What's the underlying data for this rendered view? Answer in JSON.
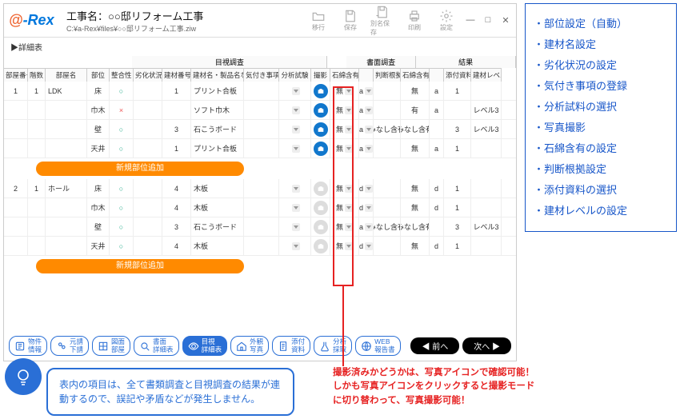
{
  "window": {
    "title_prefix": "工事名：",
    "title": "○○邸リフォーム工事",
    "path": "C:¥a-Rex¥files¥○○邸リフォーム工事.ziw",
    "toolbar": {
      "items": [
        {
          "name": "open-icon",
          "label": "移行"
        },
        {
          "name": "save-icon",
          "label": "保存"
        },
        {
          "name": "saveas-icon",
          "label": "別名保存"
        },
        {
          "name": "print-icon",
          "label": "印刷"
        },
        {
          "name": "settings-icon",
          "label": "設定"
        }
      ]
    },
    "crumb": "▶詳細表"
  },
  "header_groups": {
    "visual": "目視調査",
    "doc": "書面調査",
    "result": "結果"
  },
  "columns": {
    "a": "部屋番号",
    "b": "階数",
    "c": "部屋名",
    "d": "部位",
    "e": "整合性",
    "f": "劣化状況",
    "f2": "建材番号",
    "g": "",
    "h": "建材名・製品名など",
    "i": "気付き事項",
    "j": "分析試験",
    "k": "撮影",
    "l": "石綿含有",
    "m": "",
    "n": "判断根拠",
    "o": "石綿含有",
    "p": "",
    "q": "添付資料",
    "r": "建材レベル"
  },
  "rooms": [
    {
      "room_no": "1",
      "floor": "1",
      "room_name": "LDK",
      "rows": [
        {
          "part": "床",
          "fit": "○",
          "deg": "",
          "bno": "1",
          "bname": "プリント合板",
          "note": "",
          "anal": "",
          "cam": true,
          "asb1": "無",
          "code1": "a",
          "basis": "",
          "asb2": "無",
          "code2": "a",
          "doc": "1",
          "level": ""
        },
        {
          "part": "巾木",
          "fit": "×",
          "deg": "",
          "bno": "",
          "bname": "ソフト巾木",
          "note": "",
          "anal": "",
          "cam": true,
          "asb1": "無",
          "code1": "a",
          "basis": "",
          "asb2": "有",
          "code2": "a",
          "doc": "",
          "level": "レベル3"
        },
        {
          "part": "壁",
          "fit": "○",
          "deg": "",
          "bno": "3",
          "bname": "石こうボード",
          "note": "",
          "anal": "",
          "cam": true,
          "asb1": "無",
          "code1": "a",
          "basis": "みなし含有",
          "asb2": "みなし含有",
          "code2": "",
          "doc": "3",
          "level": "レベル3"
        },
        {
          "part": "天井",
          "fit": "○",
          "deg": "",
          "bno": "1",
          "bname": "プリント合板",
          "note": "",
          "anal": "",
          "cam": true,
          "asb1": "無",
          "code1": "a",
          "basis": "",
          "asb2": "無",
          "code2": "a",
          "doc": "1",
          "level": ""
        }
      ]
    },
    {
      "room_no": "2",
      "floor": "1",
      "room_name": "ホール",
      "rows": [
        {
          "part": "床",
          "fit": "○",
          "deg": "",
          "bno": "4",
          "bname": "木板",
          "note": "",
          "anal": "",
          "cam": false,
          "asb1": "無",
          "code1": "d",
          "basis": "",
          "asb2": "無",
          "code2": "d",
          "doc": "1",
          "level": ""
        },
        {
          "part": "巾木",
          "fit": "○",
          "deg": "",
          "bno": "4",
          "bname": "木板",
          "note": "",
          "anal": "",
          "cam": false,
          "asb1": "無",
          "code1": "d",
          "basis": "",
          "asb2": "無",
          "code2": "d",
          "doc": "1",
          "level": ""
        },
        {
          "part": "壁",
          "fit": "○",
          "deg": "",
          "bno": "3",
          "bname": "石こうボード",
          "note": "",
          "anal": "",
          "cam": false,
          "asb1": "無",
          "code1": "a",
          "basis": "みなし含有",
          "asb2": "みなし含有",
          "code2": "",
          "doc": "3",
          "level": "レベル3"
        },
        {
          "part": "天井",
          "fit": "○",
          "deg": "",
          "bno": "4",
          "bname": "木板",
          "note": "",
          "anal": "",
          "cam": false,
          "asb1": "無",
          "code1": "d",
          "basis": "",
          "asb2": "無",
          "code2": "d",
          "doc": "1",
          "level": ""
        }
      ]
    }
  ],
  "add_label": "新規部位追加",
  "bottom_tabs": [
    {
      "name": "tab-property",
      "label": "物件\n情報"
    },
    {
      "name": "tab-mototen",
      "label": "元請\n下請"
    },
    {
      "name": "tab-zumen",
      "label": "図面\n部屋"
    },
    {
      "name": "tab-shomen",
      "label": "書面\n詳細表"
    },
    {
      "name": "tab-meshi",
      "label": "目視\n詳細表",
      "active": true
    },
    {
      "name": "tab-gaikan",
      "label": "外観\n写真"
    },
    {
      "name": "tab-tenpu",
      "label": "添付\n資料"
    },
    {
      "name": "tab-bunseki",
      "label": "分析\n採取"
    },
    {
      "name": "tab-web",
      "label": "WEB\n報告書"
    }
  ],
  "nav": {
    "prev": "◀ 前へ",
    "next": "次へ ▶"
  },
  "tip": "表内の項目は、全て書類調査と目視調査の結果が連動するので、誤記や矛盾などが発生しません。",
  "red_note_1": "撮影済みかどうかは、写真アイコンで確認可能！",
  "red_note_2": "しかも写真アイコンをクリックすると撮影モードに切り替わって、写真撮影可能！",
  "side_items": [
    "部位設定（自動）",
    "建材名設定",
    "劣化状況の設定",
    "気付き事項の登録",
    "分析試料の選択",
    "写真撮影",
    "石綿含有の設定",
    "判断根拠設定",
    "添付資料の選択",
    "建材レベルの設定"
  ]
}
